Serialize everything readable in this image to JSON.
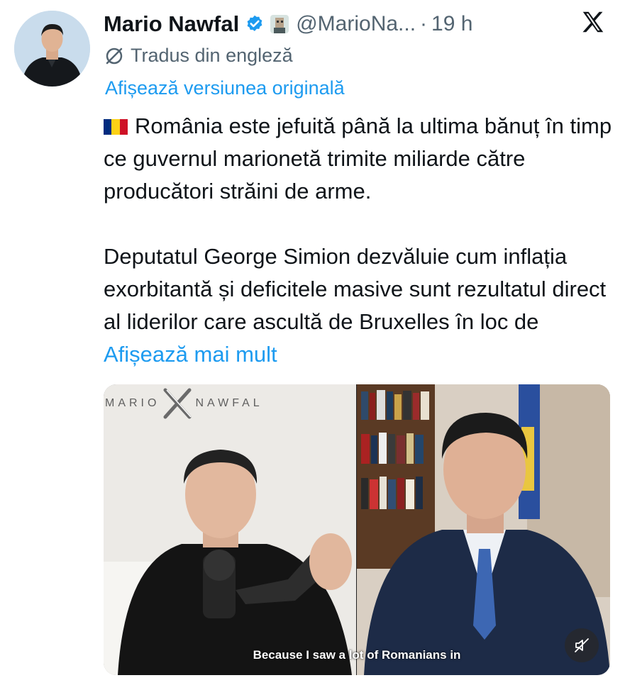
{
  "author": {
    "name": "Mario Nawfal",
    "handle": "@MarioNa...",
    "separator": "·",
    "time": "19 h"
  },
  "translation": {
    "notice": "Tradus din engleză",
    "show_original": "Afișează versiunea originală"
  },
  "tweet": {
    "line1": "România este jefuită până la ultima bănuț în timp ce guvernul marionetă trimite miliarde către producători străini de arme.",
    "line2": "Deputatul George Simion dezvăluie cum inflația exorbitantă și deficitele masive sunt rezultatul direct al liderilor care ascultă de Bruxelles în loc de",
    "show_more": "Afișează mai mult"
  },
  "media": {
    "watermark_left": "MARIO",
    "watermark_right": "NAWFAL",
    "subtitle": "Because I saw a lot of Romanians in"
  },
  "icons": {
    "verified": "verified-badge-icon",
    "translate": "translate-slash-icon",
    "x_logo": "x-logo-icon",
    "mute": "muted-speaker-icon"
  },
  "colors": {
    "link": "#1d9bf0",
    "secondary_text": "#536471",
    "primary_text": "#0f1419"
  }
}
